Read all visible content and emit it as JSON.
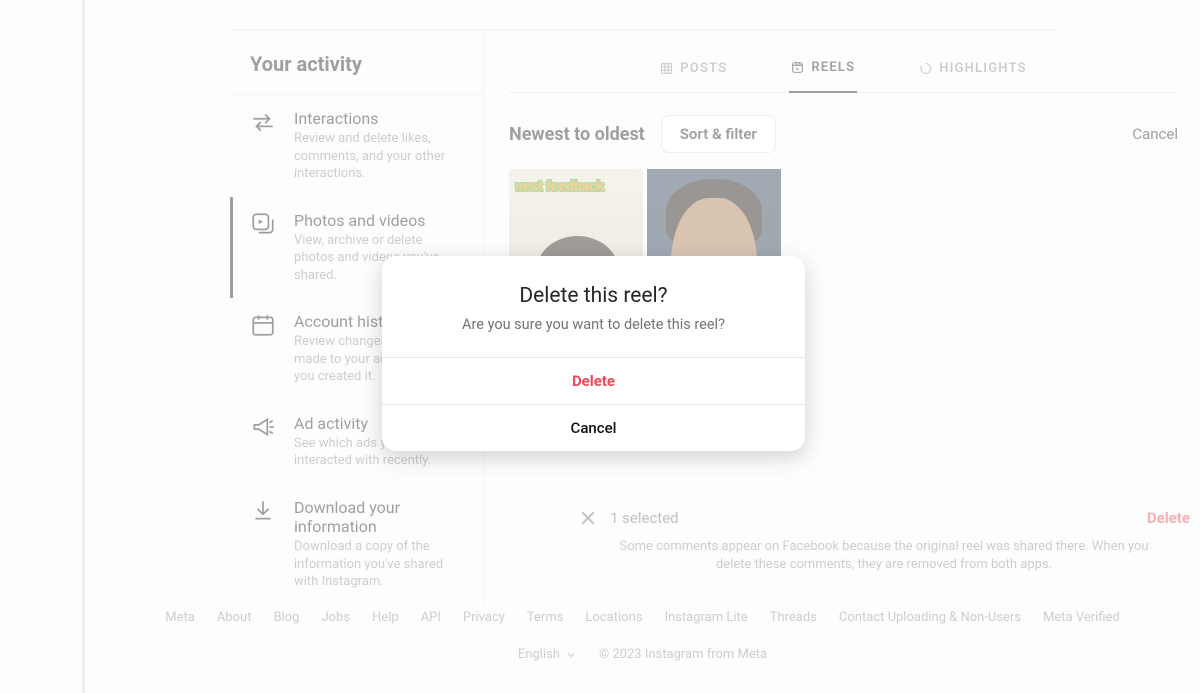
{
  "sidebar": {
    "title": "Your activity",
    "items": [
      {
        "label": "Interactions",
        "desc": "Review and delete likes, comments, and your other interactions."
      },
      {
        "label": "Photos and videos",
        "desc": "View, archive or delete photos and videos you've shared."
      },
      {
        "label": "Account history",
        "desc": "Review changes you've made to your account since you created it."
      },
      {
        "label": "Ad activity",
        "desc": "See which ads you've interacted with recently."
      },
      {
        "label": "Download your information",
        "desc": "Download a copy of the information you've shared with Instagram."
      }
    ]
  },
  "tabs": {
    "posts": "POSTS",
    "reels": "REELS",
    "highlights": "HIGHLIGHTS"
  },
  "toolbar": {
    "sort_label": "Newest to oldest",
    "sort_button": "Sort & filter",
    "cancel": "Cancel"
  },
  "thumbs": {
    "t1_caption": "uest feedback"
  },
  "selection": {
    "count_text": "1 selected",
    "delete_label": "Delete",
    "note": "Some comments appear on Facebook because the original reel was shared there. When you delete these comments, they are removed from both apps."
  },
  "footer": {
    "links": [
      "Meta",
      "About",
      "Blog",
      "Jobs",
      "Help",
      "API",
      "Privacy",
      "Terms",
      "Locations",
      "Instagram Lite",
      "Threads",
      "Contact Uploading & Non-Users",
      "Meta Verified"
    ],
    "language": "English",
    "copyright": "© 2023 Instagram from Meta"
  },
  "modal": {
    "title": "Delete this reel?",
    "message": "Are you sure you want to delete this reel?",
    "delete": "Delete",
    "cancel": "Cancel"
  }
}
